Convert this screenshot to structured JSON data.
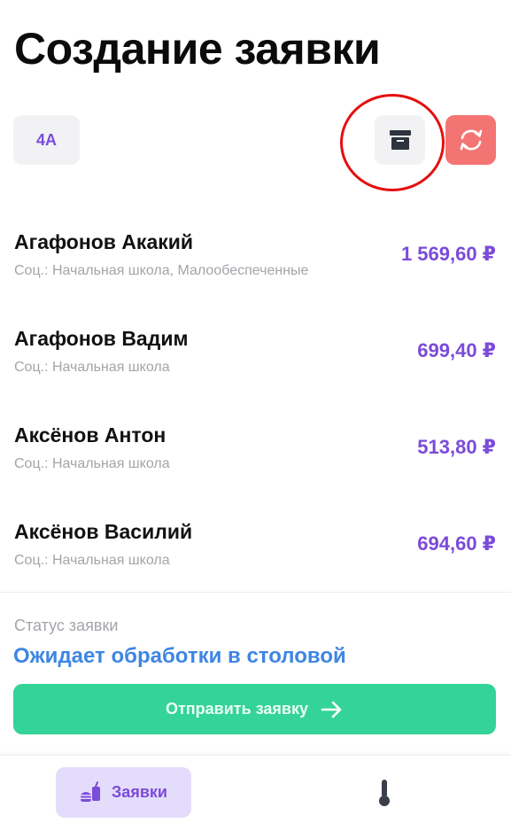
{
  "page": {
    "title": "Создание заявки"
  },
  "toolbar": {
    "class_label": "4А",
    "archive_icon": "archive-box-icon",
    "refresh_icon": "refresh-icon",
    "accent_color": "#7b4bd9",
    "refresh_color": "#f47474"
  },
  "students": [
    {
      "name": "Агафонов Акакий",
      "category": "Соц.: Начальная школа, Малообеспеченные",
      "amount": "1 569,60 ₽"
    },
    {
      "name": "Агафонов Вадим",
      "category": "Соц.: Начальная школа",
      "amount": "699,40 ₽"
    },
    {
      "name": "Аксёнов Антон",
      "category": "Соц.: Начальная школа",
      "amount": "513,80 ₽"
    },
    {
      "name": "Аксёнов Василий",
      "category": "Соц.: Начальная школа",
      "amount": "694,60 ₽"
    }
  ],
  "status": {
    "label": "Статус заявки",
    "value": "Ожидает обработки в столовой"
  },
  "submit": {
    "label": "Отправить заявку",
    "icon": "arrow-right-icon",
    "color": "#34d39a"
  },
  "bottom_nav": {
    "orders_label": "Заявки",
    "orders_icon": "food-drink-icon",
    "second_icon": "thermometer-icon"
  }
}
